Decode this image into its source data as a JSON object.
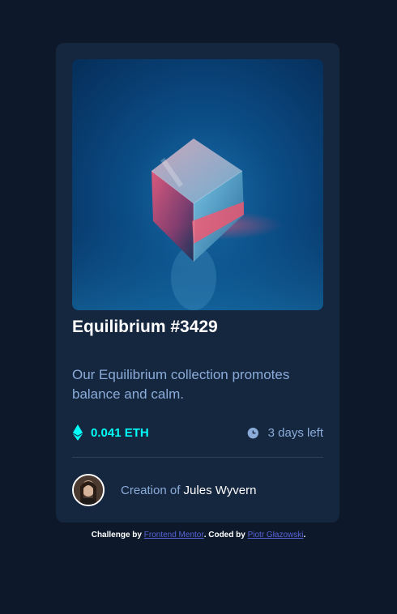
{
  "card": {
    "image_alt": "Equilibrium cube artwork",
    "title": "Equilibrium #3429",
    "description": "Our Equilibrium collection promotes balance and calm.",
    "price": "0.041 ETH",
    "time_left": "3 days left",
    "creator_prefix": "Creation of",
    "creator_name": "Jules Wyvern"
  },
  "attribution": {
    "prefix": "Challenge by",
    "challenge_link": "Frontend Mentor",
    "middle": ". Coded by",
    "author_link": "Piotr Głazowski",
    "suffix": "."
  },
  "colors": {
    "page_bg": "#0d192b",
    "card_bg": "#15263f",
    "cyan": "#00fff8",
    "soft_blue": "#8bacd9",
    "divider": "#2e405a",
    "white": "#ffffff",
    "link": "#5864d6"
  },
  "icons": [
    "eth-icon",
    "clock-icon"
  ]
}
